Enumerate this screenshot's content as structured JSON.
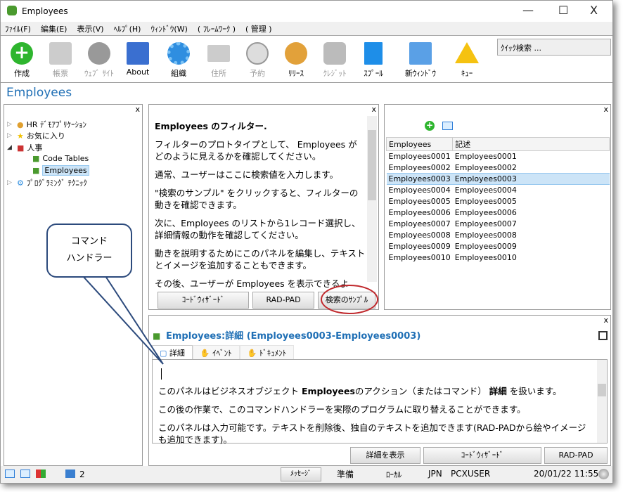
{
  "window": {
    "title": "Employees",
    "minimize": "—",
    "maximize": "☐",
    "close": "X"
  },
  "menu": [
    "ﾌｧｲﾙ(F)",
    "編集(E)",
    "表示(V)",
    "ﾍﾙﾌﾟ(H)",
    "ｳｨﾝﾄﾞｳ(W)",
    "( ﾌﾚｰﾑﾜｰｸ )",
    "( 管理 )"
  ],
  "toolbar": [
    {
      "label": "作成",
      "icon": "plus-circle-icon",
      "enabled": true
    },
    {
      "label": "帳票",
      "icon": "folder-icon",
      "enabled": false
    },
    {
      "label": "ｳｪﾌﾞ ｻｲﾄ",
      "icon": "globe-icon",
      "enabled": false
    },
    {
      "label": "About",
      "icon": "about-window-icon",
      "enabled": true
    },
    {
      "label": "組織",
      "icon": "gear-icon",
      "enabled": true
    },
    {
      "label": "住所",
      "icon": "envelope-icon",
      "enabled": false
    },
    {
      "label": "予約",
      "icon": "clock-icon",
      "enabled": false
    },
    {
      "label": "ﾘﾘｰｽ",
      "icon": "support-agent-icon",
      "enabled": true
    },
    {
      "label": "ｸﾚｼﾞｯﾄ",
      "icon": "database-icon",
      "enabled": false
    },
    {
      "label": "ｽﾌﾟｰﾙ",
      "icon": "document-icon",
      "enabled": true
    },
    {
      "label": "新ｳｨﾝﾄﾞｳ",
      "icon": "new-window-icon",
      "enabled": true
    },
    {
      "label": "ｷｭｰ",
      "icon": "warning-icon",
      "enabled": true
    }
  ],
  "quick_search": "ｸｲｯｸ検索 ...",
  "app_title": "Employees",
  "close_x": "x",
  "tree": [
    {
      "label": "HR ﾃﾞﾓｱﾌﾟﾘｹｰｼｮﾝ",
      "level": 0
    },
    {
      "label": "お気に入り",
      "level": 0
    },
    {
      "label": "人事",
      "level": 0
    },
    {
      "label": "Code Tables",
      "level": 1
    },
    {
      "label": "Employees",
      "level": 1,
      "selected": true
    },
    {
      "label": "ﾌﾟﾛｸﾞﾗﾐﾝｸﾞ ﾃｸﾆｯｸ",
      "level": 0
    }
  ],
  "filter": {
    "title": "Employees のフィルター.",
    "paragraphs": [
      "フィルターのプロトタイプとして、 Employees がどのように見えるかを確認してください。",
      "通常、ユーザーはここに検索値を入力します。",
      "\"検索のサンプル\" をクリックすると、フィルターの動きを確認できます。",
      "次に、Employees のリストから1レコード選択し、詳細情報の動作を確認してください。",
      "動きを説明するためにこのパネルを編集し、テキストとイメージを追加することもできます。",
      "その後、ユーザーが Employees を表示できるよう、"
    ],
    "buttons": [
      "ｺｰﾄﾞｳｨｻﾞｰﾄﾞ",
      "RAD-PAD",
      "検索のｻﾝﾌﾟﾙ"
    ]
  },
  "list": {
    "columns": [
      "Employees",
      "記述"
    ],
    "rows": [
      [
        "Employees0001",
        "Employees0001"
      ],
      [
        "Employees0002",
        "Employees0002"
      ],
      [
        "Employees0003",
        "Employees0003"
      ],
      [
        "Employees0004",
        "Employees0004"
      ],
      [
        "Employees0005",
        "Employees0005"
      ],
      [
        "Employees0006",
        "Employees0006"
      ],
      [
        "Employees0007",
        "Employees0007"
      ],
      [
        "Employees0008",
        "Employees0008"
      ],
      [
        "Employees0009",
        "Employees0009"
      ],
      [
        "Employees0010",
        "Employees0010"
      ]
    ],
    "selected_index": 2
  },
  "detail": {
    "title": "Employees:詳細 (Employees0003-Employees0003)",
    "tabs": [
      "詳細",
      "ｲﾍﾞﾝﾄ",
      "ﾄﾞｷｭﾒﾝﾄ"
    ],
    "p1a": "このパネルはビジネスオブジェクト ",
    "p1b": "Employees",
    "p1c": "のアクション（またはコマンド） ",
    "p1d": "詳細",
    "p1e": " を扱います。",
    "p2": "この後の作業で、このコマンドハンドラーを実際のプログラムに取り替えることができます。",
    "p3": "このパネルは入力可能です。テキストを削除後、独自のテキストを追加できます(RAD-PADから絵やイメージも追加できます)。",
    "buttons": [
      "詳細を表示",
      "ｺｰﾄﾞｳｨｻﾞｰﾄﾞ",
      "RAD-PAD"
    ]
  },
  "status": {
    "count": "2",
    "message_button": "ﾒｯｾｰｼﾞ",
    "state": "準備",
    "mode": "ﾛｰｶﾙ",
    "lang": "JPN",
    "user": "PCXUSER",
    "datetime": "20/01/22 11:55"
  },
  "callout": {
    "line1": "コマンド",
    "line2": "ハンドラー"
  }
}
